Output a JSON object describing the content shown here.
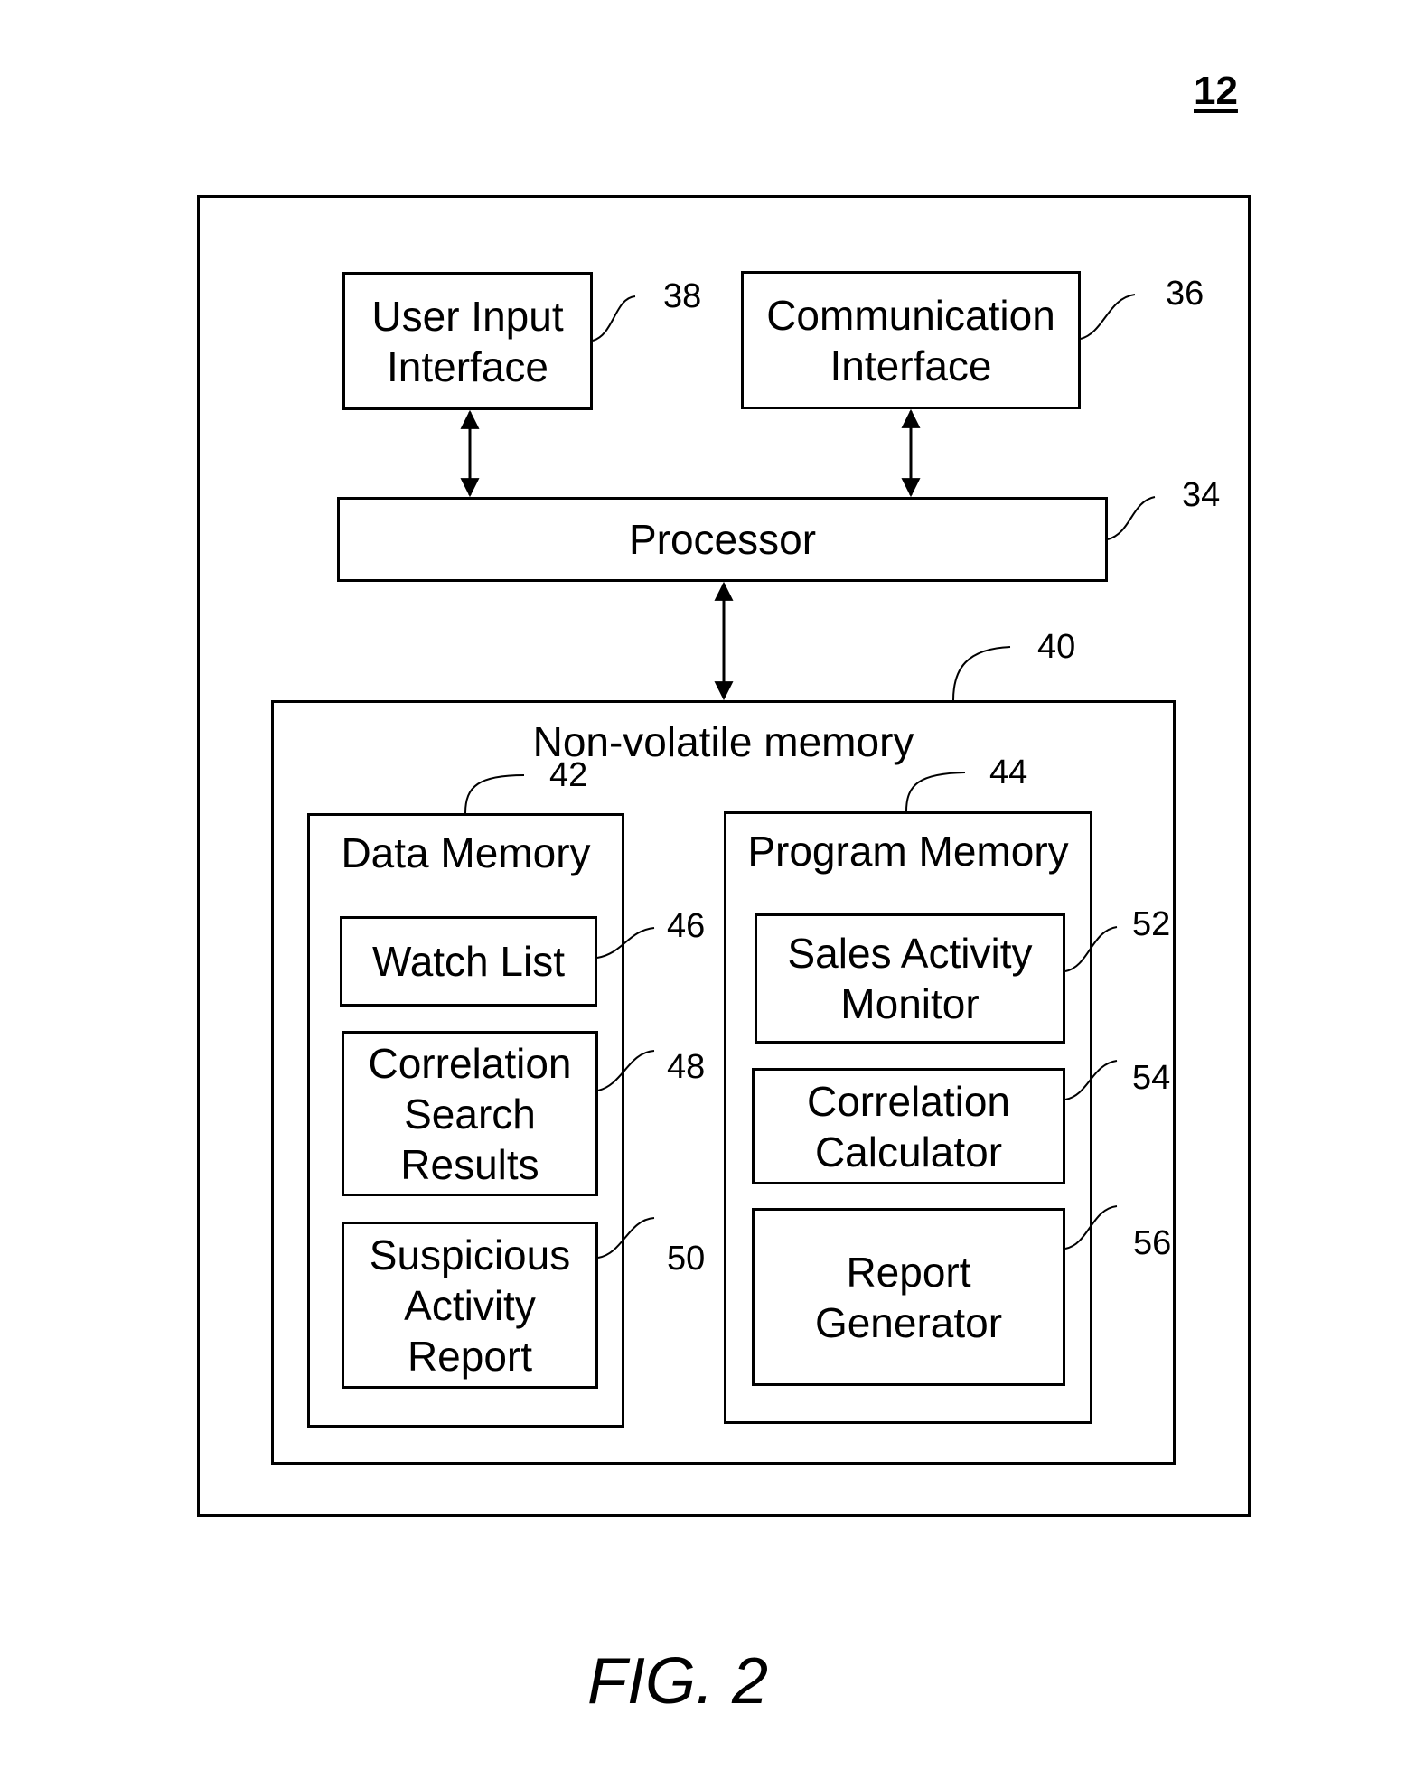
{
  "figure": {
    "reference_number": "12",
    "caption": "FIG. 2"
  },
  "blocks": {
    "user_input_interface": {
      "label_lines": [
        "User Input",
        "Interface"
      ],
      "ref": "38"
    },
    "communication_interface": {
      "label_lines": [
        "Communication",
        "Interface"
      ],
      "ref": "36"
    },
    "processor": {
      "label": "Processor",
      "ref": "34"
    },
    "non_volatile_memory": {
      "label": "Non-volatile memory",
      "ref": "40"
    },
    "data_memory": {
      "label": "Data Memory",
      "ref": "42",
      "items": [
        {
          "label_lines": [
            "Watch List"
          ],
          "ref": "46"
        },
        {
          "label_lines": [
            "Correlation",
            "Search",
            "Results"
          ],
          "ref": "48"
        },
        {
          "label_lines": [
            "Suspicious",
            "Activity",
            "Report"
          ],
          "ref": "50"
        }
      ]
    },
    "program_memory": {
      "label": "Program Memory",
      "ref": "44",
      "items": [
        {
          "label_lines": [
            "Sales Activity",
            "Monitor"
          ],
          "ref": "52"
        },
        {
          "label_lines": [
            "Correlation",
            "Calculator"
          ],
          "ref": "54"
        },
        {
          "label_lines": [
            "Report",
            "Generator"
          ],
          "ref": "56"
        }
      ]
    }
  },
  "connections": [
    {
      "from": "User Input Interface",
      "to": "Processor",
      "type": "bidirectional"
    },
    {
      "from": "Communication Interface",
      "to": "Processor",
      "type": "bidirectional"
    },
    {
      "from": "Processor",
      "to": "Non-volatile memory",
      "type": "bidirectional"
    }
  ]
}
